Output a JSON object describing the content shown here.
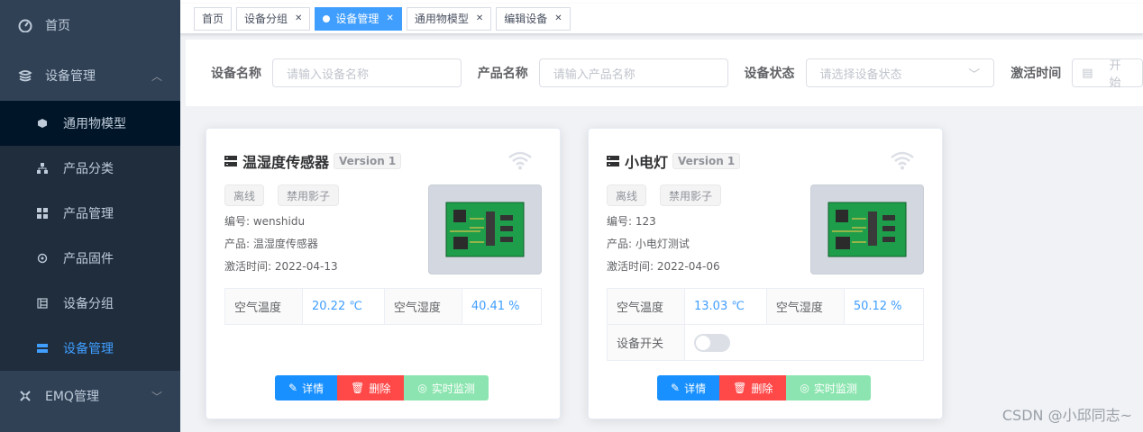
{
  "sidebar": {
    "home": "首页",
    "device_mgmt": "设备管理",
    "sub_items": [
      "通用物模型",
      "产品分类",
      "产品管理",
      "产品固件",
      "设备分组",
      "设备管理"
    ],
    "emq": "EMQ管理"
  },
  "tabs": [
    "首页",
    "设备分组",
    "设备管理",
    "通用物模型",
    "编辑设备"
  ],
  "search": {
    "name_label": "设备名称",
    "name_placeholder": "请输入设备名称",
    "product_label": "产品名称",
    "product_placeholder": "请输入产品名称",
    "status_label": "设备状态",
    "status_placeholder": "请选择设备状态",
    "activate_label": "激活时间",
    "activate_placeholder": "开始"
  },
  "cards": [
    {
      "title": "温湿度传感器",
      "version": "Version 1",
      "tag1": "离线",
      "tag2": "禁用影子",
      "code": "编号:  wenshidu",
      "product": "产品:  温湿度传感器",
      "time": "激活时间:  2022-04-13",
      "k1": "空气温度",
      "v1": "20.22 ℃",
      "k2": "空气湿度",
      "v2": "40.41 %"
    },
    {
      "title": "小电灯",
      "version": "Version 1",
      "tag1": "离线",
      "tag2": "禁用影子",
      "code": "编号:  123",
      "product": "产品:  小电灯测试",
      "time": "激活时间:  2022-04-06",
      "k1": "空气温度",
      "v1": "13.03 ℃",
      "k2": "空气湿度",
      "v2": "50.12 %",
      "k3": "设备开关"
    }
  ],
  "buttons": {
    "detail": "详情",
    "delete": "删除",
    "monitor": "实时监测"
  },
  "watermark": "CSDN @小邱同志~",
  "colors": {
    "sidebar": "#304156",
    "accent": "#409eff",
    "danger": "#ff4949",
    "success": "#8ce5b0"
  }
}
